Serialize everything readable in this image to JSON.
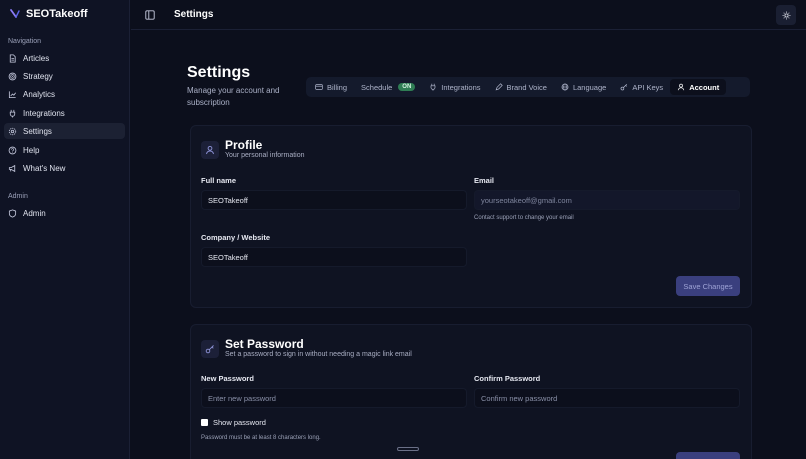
{
  "app": {
    "name": "SEOTakeoff"
  },
  "sidebar": {
    "nav_heading": "Navigation",
    "items": [
      {
        "label": "Articles",
        "icon": "file-text-icon"
      },
      {
        "label": "Strategy",
        "icon": "target-icon"
      },
      {
        "label": "Analytics",
        "icon": "chart-icon"
      },
      {
        "label": "Integrations",
        "icon": "plug-icon"
      },
      {
        "label": "Settings",
        "icon": "gear-icon",
        "active": true
      },
      {
        "label": "Help",
        "icon": "help-circle-icon"
      },
      {
        "label": "What's New",
        "icon": "megaphone-icon"
      }
    ],
    "admin_heading": "Admin",
    "admin_items": [
      {
        "label": "Admin",
        "icon": "shield-icon"
      }
    ]
  },
  "topbar": {
    "title": "Settings"
  },
  "page": {
    "title": "Settings",
    "subtitle": "Manage your account and subscription"
  },
  "tabs": [
    {
      "label": "Billing",
      "icon": "credit-card-icon"
    },
    {
      "label": "Schedule",
      "badge": "ON"
    },
    {
      "label": "Integrations",
      "icon": "plug-icon"
    },
    {
      "label": "Brand Voice",
      "icon": "pen-icon"
    },
    {
      "label": "Language",
      "icon": "globe-icon"
    },
    {
      "label": "API Keys",
      "icon": "key-icon"
    },
    {
      "label": "Account",
      "icon": "user-icon",
      "active": true
    }
  ],
  "profile": {
    "title": "Profile",
    "subtitle": "Your personal information",
    "full_name_label": "Full name",
    "full_name_value": "SEOTakeoff",
    "email_label": "Email",
    "email_value": "yourseotakeoff@gmail.com",
    "email_hint": "Contact support to change your email",
    "company_label": "Company / Website",
    "company_value": "SEOTakeoff",
    "save_label": "Save Changes"
  },
  "password": {
    "title": "Set Password",
    "subtitle": "Set a password to sign in without needing a magic link email",
    "new_label": "New Password",
    "new_placeholder": "Enter new password",
    "confirm_label": "Confirm Password",
    "confirm_placeholder": "Confirm new password",
    "show_label": "Show password",
    "hint": "Password must be at least 8 characters long."
  },
  "colors": {
    "background": "#0c0f1c",
    "sidebar": "#0f1324",
    "accent": "#3a3f7e",
    "badge": "#2f7d54"
  }
}
